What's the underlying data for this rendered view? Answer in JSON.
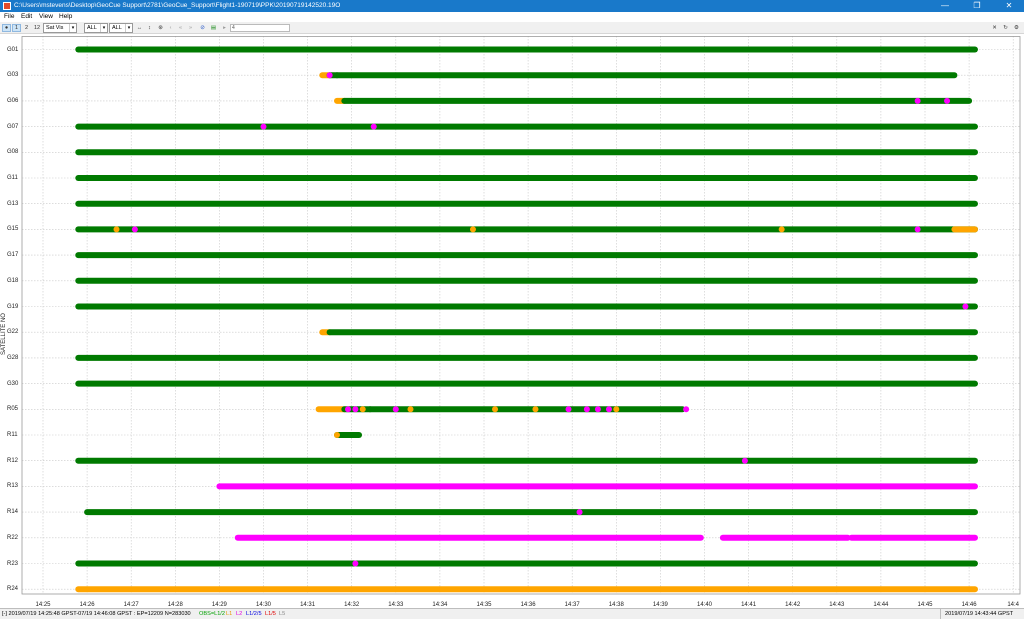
{
  "window": {
    "title": "C:\\Users\\mstevens\\Desktop\\GeoCue Support\\2781\\GeoCue_Support\\Flight1-190719\\PPK\\20190719142520.19O",
    "minimize": "—",
    "maximize": "❐",
    "close": "✕"
  },
  "menu": [
    "File",
    "Edit",
    "View",
    "Help"
  ],
  "toolbar": {
    "view_buttons": [
      "●",
      "1",
      "2",
      "12"
    ],
    "plot_type": "Sat Vis",
    "sys_filter": "ALL",
    "sat_filter": "ALL",
    "slider_value": "4"
  },
  "plot": {
    "axis_title": "SATELLITE NO",
    "colors": {
      "obs": "#007a00",
      "l1": "#ffa500",
      "l2": "#ff00ff",
      "grid": "#c8c8c8"
    },
    "satellites": [
      "G01",
      "G03",
      "G06",
      "G07",
      "G08",
      "G11",
      "G13",
      "G15",
      "G17",
      "G18",
      "G19",
      "G22",
      "G28",
      "G30",
      "R05",
      "R11",
      "R12",
      "R13",
      "R14",
      "R22",
      "R23",
      "R24"
    ],
    "time_ticks": [
      "14:25",
      "14:26",
      "14:27",
      "14:28",
      "14:29",
      "14:30",
      "14:31",
      "14:32",
      "14:33",
      "14:34",
      "14:35",
      "14:36",
      "14:37",
      "14:38",
      "14:39",
      "14:40",
      "14:41",
      "14:42",
      "14:43",
      "14:44",
      "14:45",
      "14:46",
      "14:4"
    ],
    "tracks": [
      {
        "sat": "G01",
        "segments": [
          {
            "start": "14:25:48",
            "end": "14:46:08",
            "color": "obs"
          }
        ],
        "marks": []
      },
      {
        "sat": "G03",
        "segments": [
          {
            "start": "14:31:20",
            "end": "14:31:30",
            "color": "l1"
          },
          {
            "start": "14:31:30",
            "end": "14:45:40",
            "color": "obs"
          }
        ],
        "marks": [
          {
            "time": "14:31:30",
            "color": "l2"
          },
          {
            "time": "14:31:40",
            "color": "obs"
          }
        ]
      },
      {
        "sat": "G06",
        "segments": [
          {
            "start": "14:31:40",
            "end": "14:31:50",
            "color": "l1"
          },
          {
            "start": "14:31:50",
            "end": "14:46:00",
            "color": "obs"
          }
        ],
        "marks": [
          {
            "time": "14:44:50",
            "color": "l2"
          },
          {
            "time": "14:45:30",
            "color": "l2"
          }
        ]
      },
      {
        "sat": "G07",
        "segments": [
          {
            "start": "14:25:48",
            "end": "14:46:08",
            "color": "obs"
          }
        ],
        "marks": [
          {
            "time": "14:30:00",
            "color": "l2"
          },
          {
            "time": "14:32:30",
            "color": "l2"
          }
        ]
      },
      {
        "sat": "G08",
        "segments": [
          {
            "start": "14:25:48",
            "end": "14:46:08",
            "color": "obs"
          }
        ],
        "marks": []
      },
      {
        "sat": "G11",
        "segments": [
          {
            "start": "14:25:48",
            "end": "14:46:08",
            "color": "obs"
          }
        ],
        "marks": []
      },
      {
        "sat": "G13",
        "segments": [
          {
            "start": "14:25:48",
            "end": "14:46:08",
            "color": "obs"
          }
        ],
        "marks": []
      },
      {
        "sat": "G15",
        "segments": [
          {
            "start": "14:25:48",
            "end": "14:46:08",
            "color": "obs"
          },
          {
            "start": "14:45:40",
            "end": "14:46:08",
            "color": "l1"
          }
        ],
        "marks": [
          {
            "time": "14:26:40",
            "color": "l1"
          },
          {
            "time": "14:27:05",
            "color": "l2"
          },
          {
            "time": "14:34:45",
            "color": "l1"
          },
          {
            "time": "14:41:45",
            "color": "l1"
          },
          {
            "time": "14:44:50",
            "color": "l2"
          }
        ]
      },
      {
        "sat": "G17",
        "segments": [
          {
            "start": "14:25:48",
            "end": "14:46:08",
            "color": "obs"
          }
        ],
        "marks": []
      },
      {
        "sat": "G18",
        "segments": [
          {
            "start": "14:25:48",
            "end": "14:46:08",
            "color": "obs"
          }
        ],
        "marks": []
      },
      {
        "sat": "G19",
        "segments": [
          {
            "start": "14:25:48",
            "end": "14:46:08",
            "color": "obs"
          }
        ],
        "marks": [
          {
            "time": "14:45:55",
            "color": "l2"
          }
        ]
      },
      {
        "sat": "G22",
        "segments": [
          {
            "start": "14:31:20",
            "end": "14:31:30",
            "color": "l1"
          },
          {
            "start": "14:31:30",
            "end": "14:46:08",
            "color": "obs"
          }
        ],
        "marks": []
      },
      {
        "sat": "G28",
        "segments": [
          {
            "start": "14:25:48",
            "end": "14:46:08",
            "color": "obs"
          }
        ],
        "marks": []
      },
      {
        "sat": "G30",
        "segments": [
          {
            "start": "14:25:48",
            "end": "14:46:08",
            "color": "obs"
          }
        ],
        "marks": []
      },
      {
        "sat": "R05",
        "segments": [
          {
            "start": "14:31:15",
            "end": "14:31:50",
            "color": "l1"
          },
          {
            "start": "14:31:50",
            "end": "14:39:30",
            "color": "obs"
          }
        ],
        "marks": [
          {
            "time": "14:31:55",
            "color": "l2"
          },
          {
            "time": "14:32:05",
            "color": "l2"
          },
          {
            "time": "14:32:15",
            "color": "l1"
          },
          {
            "time": "14:32:25",
            "color": "obs"
          },
          {
            "time": "14:33:00",
            "color": "l2"
          },
          {
            "time": "14:33:20",
            "color": "l1"
          },
          {
            "time": "14:35:15",
            "color": "l1"
          },
          {
            "time": "14:36:10",
            "color": "l1"
          },
          {
            "time": "14:36:55",
            "color": "l2"
          },
          {
            "time": "14:37:20",
            "color": "l2"
          },
          {
            "time": "14:37:35",
            "color": "l2"
          },
          {
            "time": "14:37:50",
            "color": "l2"
          },
          {
            "time": "14:38:00",
            "color": "l1"
          },
          {
            "time": "14:39:35",
            "color": "l2"
          }
        ]
      },
      {
        "sat": "R11",
        "segments": [
          {
            "start": "14:31:40",
            "end": "14:32:10",
            "color": "obs"
          }
        ],
        "marks": [
          {
            "time": "14:31:40",
            "color": "l1"
          }
        ]
      },
      {
        "sat": "R12",
        "segments": [
          {
            "start": "14:25:48",
            "end": "14:46:08",
            "color": "obs"
          }
        ],
        "marks": [
          {
            "time": "14:40:55",
            "color": "l2"
          }
        ]
      },
      {
        "sat": "R13",
        "segments": [
          {
            "start": "14:29:00",
            "end": "14:46:08",
            "color": "l2"
          }
        ],
        "marks": []
      },
      {
        "sat": "R14",
        "segments": [
          {
            "start": "14:26:00",
            "end": "14:46:08",
            "color": "obs"
          }
        ],
        "marks": [
          {
            "time": "14:37:10",
            "color": "l2"
          }
        ]
      },
      {
        "sat": "R22",
        "segments": [
          {
            "start": "14:29:25",
            "end": "14:39:55",
            "color": "l2"
          },
          {
            "start": "14:40:25",
            "end": "14:43:15",
            "color": "l2"
          },
          {
            "start": "14:43:20",
            "end": "14:46:08",
            "color": "l2"
          }
        ],
        "marks": []
      },
      {
        "sat": "R23",
        "segments": [
          {
            "start": "14:25:48",
            "end": "14:46:08",
            "color": "obs"
          }
        ],
        "marks": [
          {
            "time": "14:32:05",
            "color": "l2"
          }
        ]
      },
      {
        "sat": "R24",
        "segments": [
          {
            "start": "14:25:48",
            "end": "14:46:08",
            "color": "l1"
          }
        ],
        "marks": []
      }
    ]
  },
  "status": {
    "left": "[-] 2019/07/19 14:25:48 GPST-07/19 14:46:08 GPST : EP=12209 N=283030",
    "obs": "OBS=L1/2",
    "l1": "L1",
    "l2": "L2",
    "l12": "L1/2/5",
    "l15": "L1/5",
    "l5": "L5",
    "right": "2019/07/19 14:43:44 GPST"
  }
}
